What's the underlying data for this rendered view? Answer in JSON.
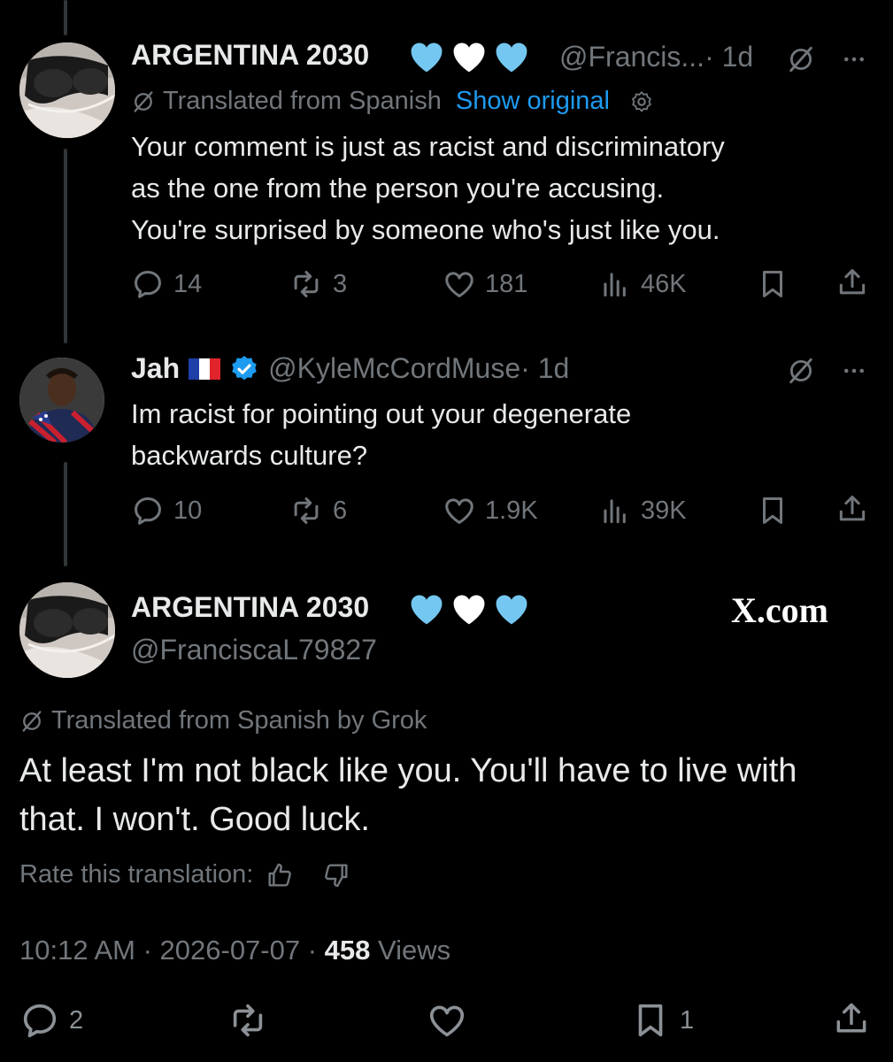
{
  "tweet1": {
    "name": "ARGENTINA 2030",
    "handle": "@Francis...",
    "time": "· 1d",
    "translated_label": "Translated from Spanish",
    "show_original": "Show original",
    "lines": [
      "Your comment is just as racist and discriminatory",
      "as the one from the person you're accusing.",
      "You're surprised by someone who's just like you."
    ],
    "replies": "14",
    "reposts": "3",
    "likes": "181",
    "views": "46K"
  },
  "tweet2": {
    "name": "Jah",
    "handle": "@KyleMcCordMuse",
    "time": "· 1d",
    "lines": [
      "Im racist for pointing out your degenerate",
      "backwards culture?"
    ],
    "replies": "10",
    "reposts": "6",
    "likes": "1.9K",
    "views": "39K"
  },
  "main": {
    "name": "ARGENTINA 2030",
    "handle": "@FranciscaL79827",
    "watermark": "X.com",
    "translated_label": "Translated from Spanish by Grok",
    "lines": [
      "At least I'm not black like you. You'll have to live with",
      "that. I won't. Good luck."
    ],
    "rate_label": "Rate this translation:",
    "timestamp": "10:12 AM · 2026-07-07 · ",
    "views_count": "458",
    "views_label": " Views",
    "replies": "2",
    "bookmarks": "1"
  },
  "colors": {
    "background": "#000000",
    "text": "#e7e9ea",
    "muted": "#71767b",
    "link": "#1d9bf0",
    "heart_blue": "#74c7f0",
    "heart_white": "#ffffff",
    "verified": "#1d9bf0"
  },
  "icons": [
    "reply-icon",
    "repost-icon",
    "like-icon",
    "views-icon",
    "bookmark-icon",
    "share-icon",
    "grok-icon",
    "more-icon",
    "gear-icon",
    "thumbs-up-icon",
    "thumbs-down-icon",
    "french-flag-icon",
    "verified-badge-icon",
    "heart-emoji"
  ]
}
